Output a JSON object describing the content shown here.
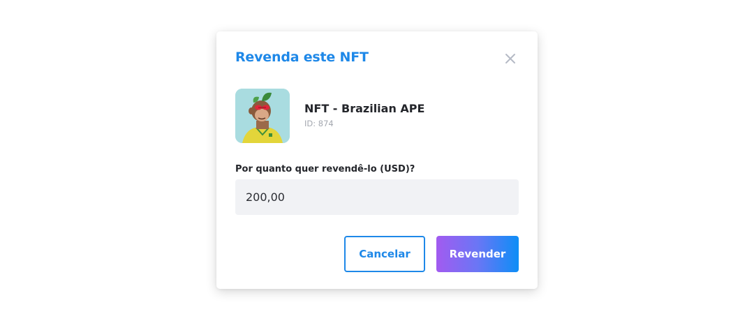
{
  "modal": {
    "title": "Revenda este NFT",
    "close_icon": "close-icon"
  },
  "nft": {
    "name": "NFT - Brazilian APE",
    "id_text": "ID: 874",
    "image_icon": "ape-avatar-image"
  },
  "price": {
    "label": "Por quanto quer revendê-lo (USD)?",
    "value": "200,00"
  },
  "actions": {
    "cancel_label": "Cancelar",
    "resell_label": "Revender"
  },
  "colors": {
    "accent": "#1e88e8",
    "gradient_start": "#a25bf0",
    "gradient_end": "#0d8ef6",
    "input_bg": "#f1f2f5"
  }
}
